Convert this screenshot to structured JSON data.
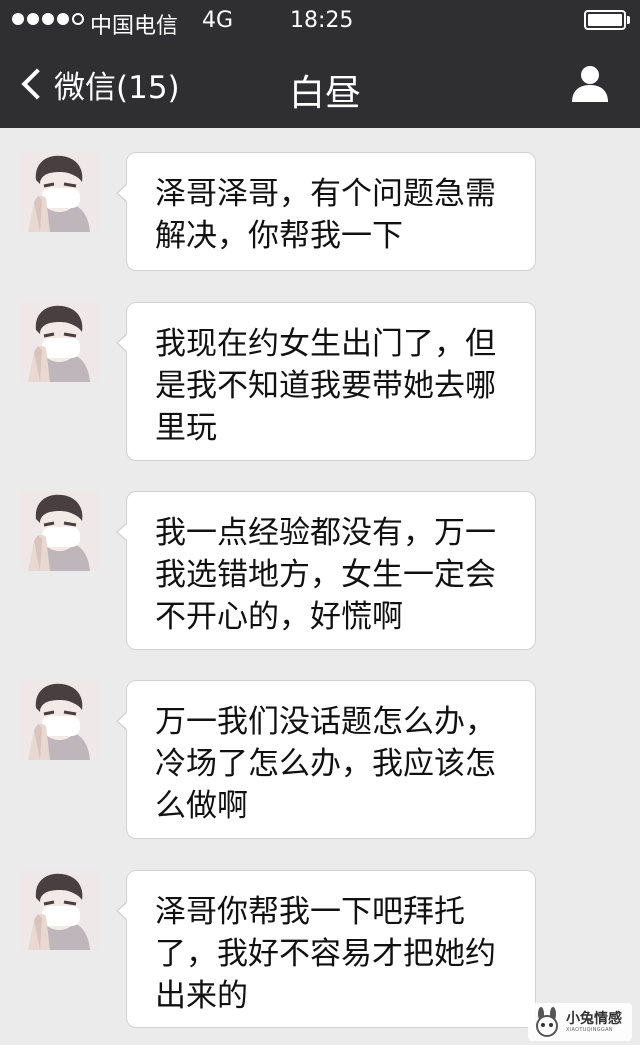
{
  "status_bar": {
    "carrier": "中国电信",
    "network": "4G",
    "time": "18:25",
    "signal_bars_filled": 4,
    "signal_bars_total": 5
  },
  "nav": {
    "back_label": "微信(15)",
    "title": "白昼"
  },
  "messages": [
    {
      "text": "泽哥泽哥，有个问题急需解决，你帮我一下"
    },
    {
      "text": "我现在约女生出门了，但是我不知道我要带她去哪里玩"
    },
    {
      "text": "我一点经验都没有，万一我选错地方，女生一定会不开心的，好慌啊"
    },
    {
      "text": "万一我们没话题怎么办，冷场了怎么办，我应该怎么做啊"
    },
    {
      "text": "泽哥你帮我一下吧拜托了，我好不容易才把她约出来的"
    }
  ],
  "watermark": {
    "main": "小兔情感",
    "sub": "XIAOTUQINGGAN"
  },
  "colors": {
    "header_bg": "#2f2f31",
    "chat_bg": "#ebebeb",
    "bubble_bg": "#ffffff",
    "bubble_border": "#d2d2d2"
  }
}
